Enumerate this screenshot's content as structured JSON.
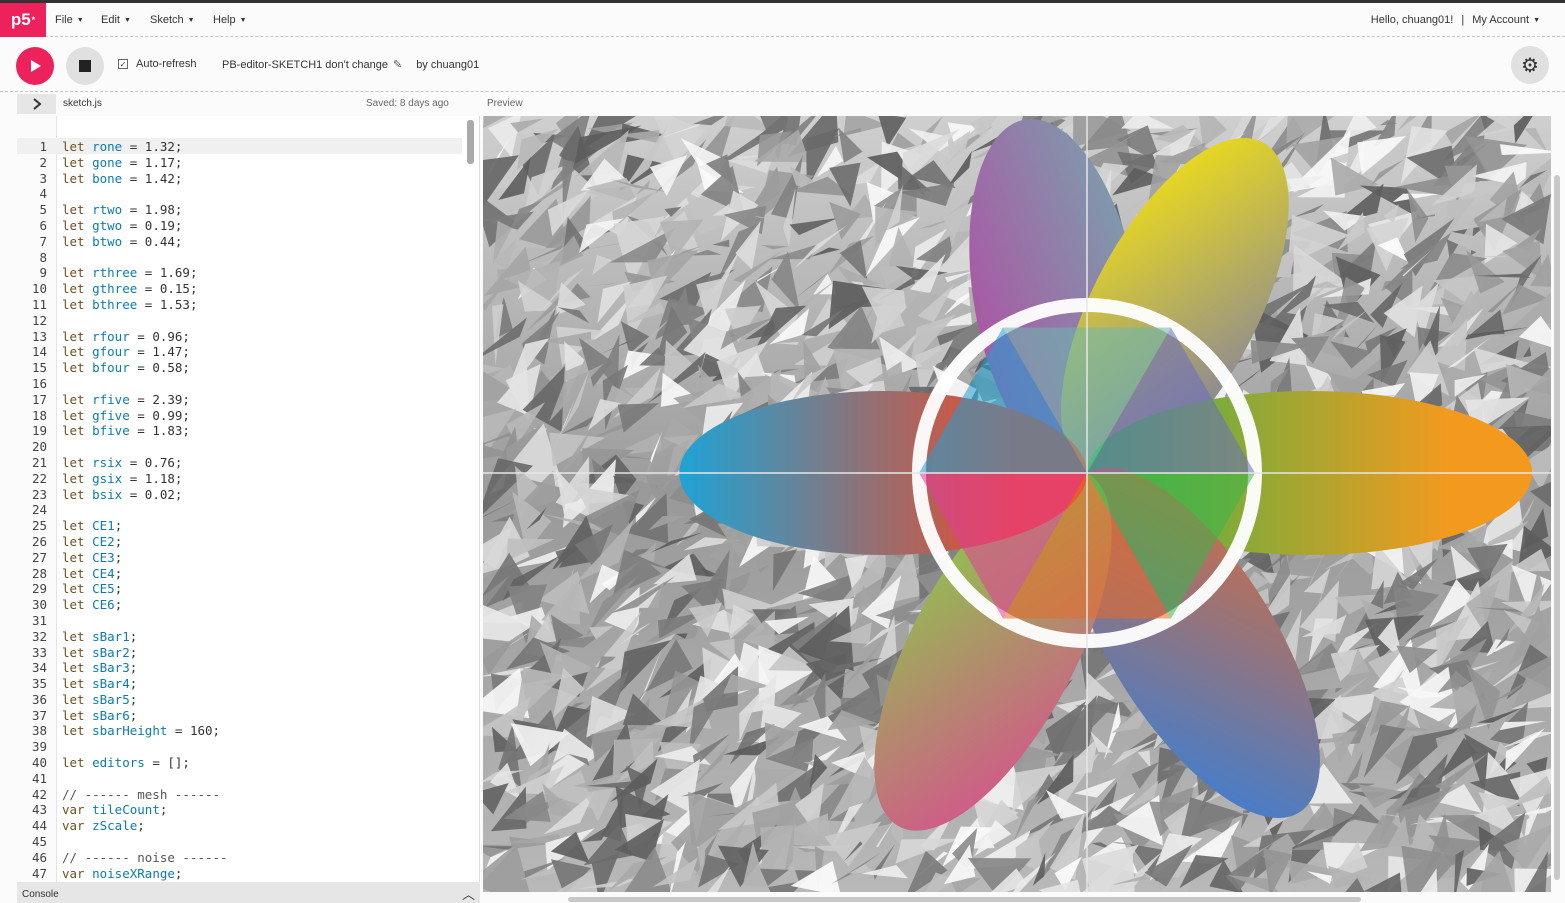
{
  "nav": {
    "logo": "p5",
    "logo_sup": "*",
    "menus": [
      "File",
      "Edit",
      "Sketch",
      "Help"
    ],
    "greeting": "Hello, chuang01!",
    "separator": "|",
    "account": "My Account"
  },
  "toolbar": {
    "auto_refresh_label": "Auto-refresh",
    "auto_refresh_checked": true,
    "sketch_name": "PB-editor-SKETCH1 don't change",
    "author": "by chuang01"
  },
  "filebar": {
    "filename": "sketch.js",
    "saved": "Saved: 8 days ago",
    "preview_label": "Preview"
  },
  "console": {
    "label": "Console"
  },
  "code": [
    "let rone = 1.32;",
    "let gone = 1.17;",
    "let bone = 1.42;",
    "",
    "let rtwo = 1.98;",
    "let gtwo = 0.19;",
    "let btwo = 0.44;",
    "",
    "let rthree = 1.69;",
    "let gthree = 0.15;",
    "let bthree = 1.53;",
    "",
    "let rfour = 0.96;",
    "let gfour = 1.47;",
    "let bfour = 0.58;",
    "",
    "let rfive = 2.39;",
    "let gfive = 0.99;",
    "let bfive = 1.83;",
    "",
    "let rsix = 0.76;",
    "let gsix = 1.18;",
    "let bsix = 0.02;",
    "",
    "let CE1;",
    "let CE2;",
    "let CE3;",
    "let CE4;",
    "let CE5;",
    "let CE6;",
    "",
    "let sBar1;",
    "let sBar2;",
    "let sBar3;",
    "let sBar4;",
    "let sBar5;",
    "let sBar6;",
    "let sbarHeight = 160;",
    "",
    "let editors = [];",
    "",
    "// ------ mesh ------",
    "var tileCount;",
    "var zScale;",
    "",
    "// ------ noise ------",
    "var noiseXRange;"
  ],
  "colors": {
    "accent": "#ed225d",
    "petal_top_left": [
      "#b04fa3",
      "#6ab9b0"
    ],
    "petal_top_right": [
      "#e8d820",
      "#6a6cbf"
    ],
    "petal_right": [
      "#f39a1e",
      "#3cb54a"
    ],
    "petal_bottom_right": [
      "#4a7dc6",
      "#e86a2a"
    ],
    "petal_bottom_left": [
      "#8ec44d",
      "#e43c9a"
    ],
    "petal_left": [
      "#e84b2c",
      "#1ea3d6"
    ]
  },
  "icons": {
    "play": "play-icon",
    "stop": "stop-icon",
    "settings": "gear-icon",
    "expand": "chevron-right-icon",
    "console_toggle": "chevron-up-icon",
    "edit": "pencil-icon"
  }
}
